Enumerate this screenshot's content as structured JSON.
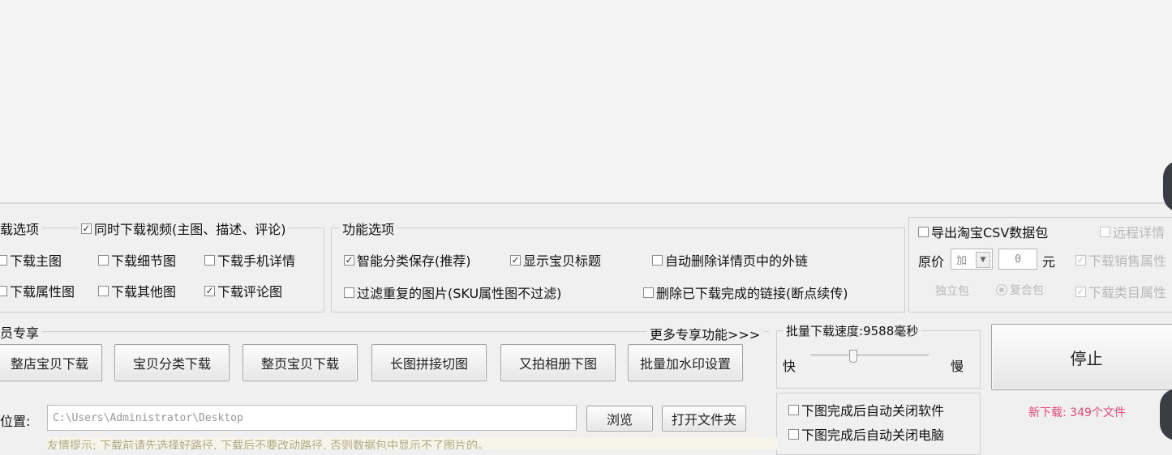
{
  "download_options": {
    "header": "载选项",
    "video_checkbox": "同时下载视频(主图、描述、评论)",
    "items": [
      {
        "label": "下载主图",
        "checked": false
      },
      {
        "label": "下载细节图",
        "checked": false
      },
      {
        "label": "下载手机详情",
        "checked": false
      },
      {
        "label": "下载属性图",
        "checked": false
      },
      {
        "label": "下载其他图",
        "checked": false
      },
      {
        "label": "下载评论图",
        "checked": true
      }
    ]
  },
  "function_options": {
    "header": "功能选项",
    "items": [
      {
        "label": "智能分类保存(推荐)",
        "checked": true
      },
      {
        "label": "显示宝贝标题",
        "checked": true
      },
      {
        "label": "自动删除详情页中的外链",
        "checked": false
      },
      {
        "label": "过滤重复的图片(SKU属性图不过滤)",
        "checked": false
      },
      {
        "label": "删除已下载完成的链接(断点续传)",
        "checked": false
      }
    ]
  },
  "right_options": {
    "export_csv": "导出淘宝CSV数据包",
    "remote_detail": "远程详情",
    "price_label": "原价",
    "price_mode": "加",
    "price_value": "0",
    "price_unit": "元",
    "download_sales_attr": "下载销售属性",
    "standalone": "独立包",
    "combined": "复合包",
    "download_category": "下载类目属性"
  },
  "member": {
    "header": "员专享",
    "more_link": "更多专享功能>>>",
    "buttons": [
      "整店宝贝下载",
      "宝贝分类下载",
      "整页宝贝下载",
      "长图拼接切图",
      "又拍相册下图",
      "批量加水印设置"
    ]
  },
  "speed": {
    "label": "批量下载速度:",
    "value": "9588毫秒",
    "fast": "快",
    "slow": "慢",
    "slider_fraction": 0.35
  },
  "after_done": {
    "close_software": "下图完成后自动关闭软件",
    "shutdown": "下图完成后自动关闭电脑"
  },
  "stop_button": "停止",
  "status": "新下载: 349个文件",
  "path": {
    "label": "位置:",
    "value": "C:\\Users\\Administrator\\Desktop",
    "browse": "浏览",
    "open_folder": "打开文件夹"
  },
  "hint": "友情提示: 下载前请先选择好路径, 下载后不要改动路径, 否则数据包中显示不了图片的。",
  "colors": {
    "status": "#e8457a",
    "accent_box": "#8a8a8a"
  }
}
